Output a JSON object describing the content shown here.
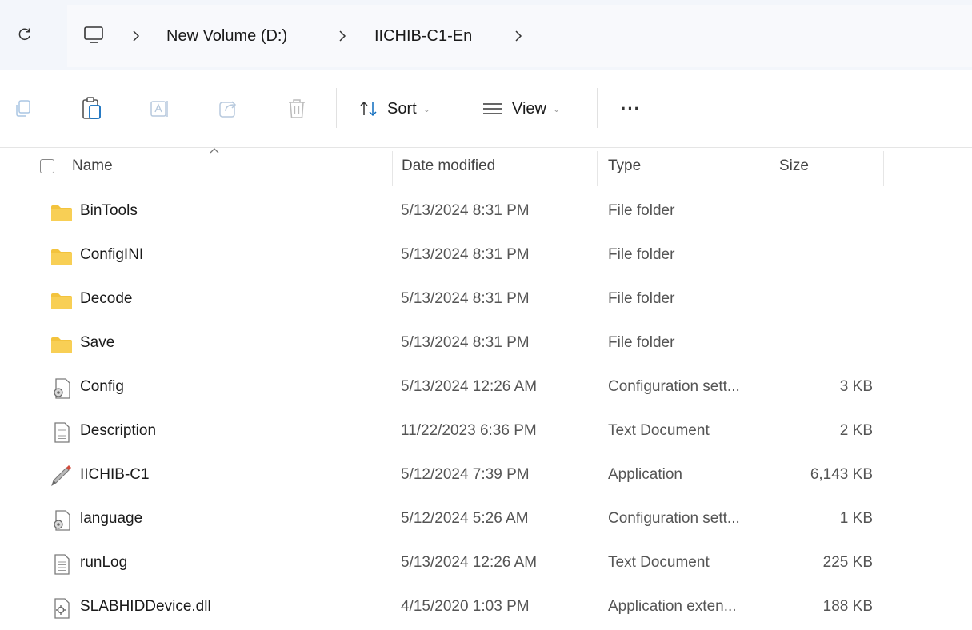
{
  "breadcrumb": [
    "New Volume (D:)",
    "IICHIB-C1-En"
  ],
  "toolbar": {
    "sort_label": "Sort",
    "view_label": "View",
    "more_label": "···"
  },
  "columns": {
    "name": "Name",
    "date": "Date modified",
    "type": "Type",
    "size": "Size"
  },
  "files": [
    {
      "name": "BinTools",
      "date": "5/13/2024 8:31 PM",
      "type": "File folder",
      "size": "",
      "icon": "folder-icon"
    },
    {
      "name": "ConfigINI",
      "date": "5/13/2024 8:31 PM",
      "type": "File folder",
      "size": "",
      "icon": "folder-icon"
    },
    {
      "name": "Decode",
      "date": "5/13/2024 8:31 PM",
      "type": "File folder",
      "size": "",
      "icon": "folder-icon"
    },
    {
      "name": "Save",
      "date": "5/13/2024 8:31 PM",
      "type": "File folder",
      "size": "",
      "icon": "folder-icon"
    },
    {
      "name": "Config",
      "date": "5/13/2024 12:26 AM",
      "type": "Configuration sett...",
      "size": "3 KB",
      "icon": "config-file-icon"
    },
    {
      "name": "Description",
      "date": "11/22/2023 6:36 PM",
      "type": "Text Document",
      "size": "2 KB",
      "icon": "text-file-icon"
    },
    {
      "name": "IICHIB-C1",
      "date": "5/12/2024 7:39 PM",
      "type": "Application",
      "size": "6,143 KB",
      "icon": "application-icon"
    },
    {
      "name": "language",
      "date": "5/12/2024 5:26 AM",
      "type": "Configuration sett...",
      "size": "1 KB",
      "icon": "config-file-icon"
    },
    {
      "name": "runLog",
      "date": "5/13/2024 12:26 AM",
      "type": "Text Document",
      "size": "225 KB",
      "icon": "text-file-icon"
    },
    {
      "name": "SLABHIDDevice.dll",
      "date": "4/15/2020 1:03 PM",
      "type": "Application exten...",
      "size": "188 KB",
      "icon": "dll-file-icon"
    }
  ],
  "colors": {
    "folder": "#f3c33d",
    "address_bg": "#f3f6fb",
    "accent": "#0f6cbd"
  }
}
